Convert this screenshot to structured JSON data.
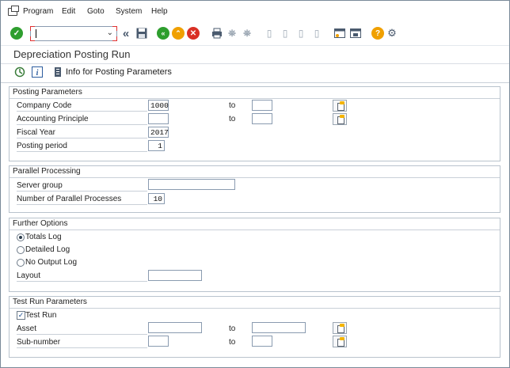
{
  "menu": {
    "items": [
      "Program",
      "Edit",
      "Goto",
      "System",
      "Help"
    ],
    "underline": [
      "P",
      "E",
      "G",
      "S",
      "H"
    ]
  },
  "toolbar": {
    "command_value": "",
    "icons": [
      "enter-icon",
      "back-icon",
      "save-icon",
      "back-green-icon",
      "exit-icon",
      "cancel-icon",
      "print-icon",
      "find-icon",
      "find-next-icon",
      "first-page-icon",
      "prev-page-icon",
      "next-page-icon",
      "last-page-icon",
      "new-session-icon",
      "shortcut-icon",
      "help-icon",
      "settings-icon"
    ]
  },
  "title": "Depreciation Posting Run",
  "app_toolbar": {
    "info_label": "Info for Posting Parameters"
  },
  "groups": {
    "posting": {
      "title": "Posting Parameters",
      "company_code_label": "Company Code",
      "company_code_value": "1000",
      "company_code_to": "",
      "accounting_principle_label": "Accounting Principle",
      "accounting_principle_value": "",
      "accounting_principle_to": "",
      "fiscal_year_label": "Fiscal Year",
      "fiscal_year_value": "2017",
      "posting_period_label": "Posting period",
      "posting_period_value": "1",
      "to_label": "to"
    },
    "parallel": {
      "title": "Parallel Processing",
      "server_group_label": "Server group",
      "server_group_value": "",
      "processes_label": "Number of Parallel Processes",
      "processes_value": "10"
    },
    "further": {
      "title": "Further Options",
      "totals_log": "Totals Log",
      "detailed_log": "Detailed Log",
      "no_output_log": "No Output Log",
      "selected": "totals_log",
      "layout_label": "Layout",
      "layout_value": ""
    },
    "testrun": {
      "title": "Test Run Parameters",
      "test_run_label": "Test Run",
      "test_run_checked": true,
      "asset_label": "Asset",
      "asset_value": "",
      "asset_to": "",
      "subnumber_label": "Sub-number",
      "subnumber_value": "",
      "subnumber_to": "",
      "to_label": "to"
    }
  },
  "colors": {
    "green": "#2e9e2e",
    "orange": "#f0a000",
    "red": "#d93025",
    "blue_grey": "#5a6f8a"
  }
}
